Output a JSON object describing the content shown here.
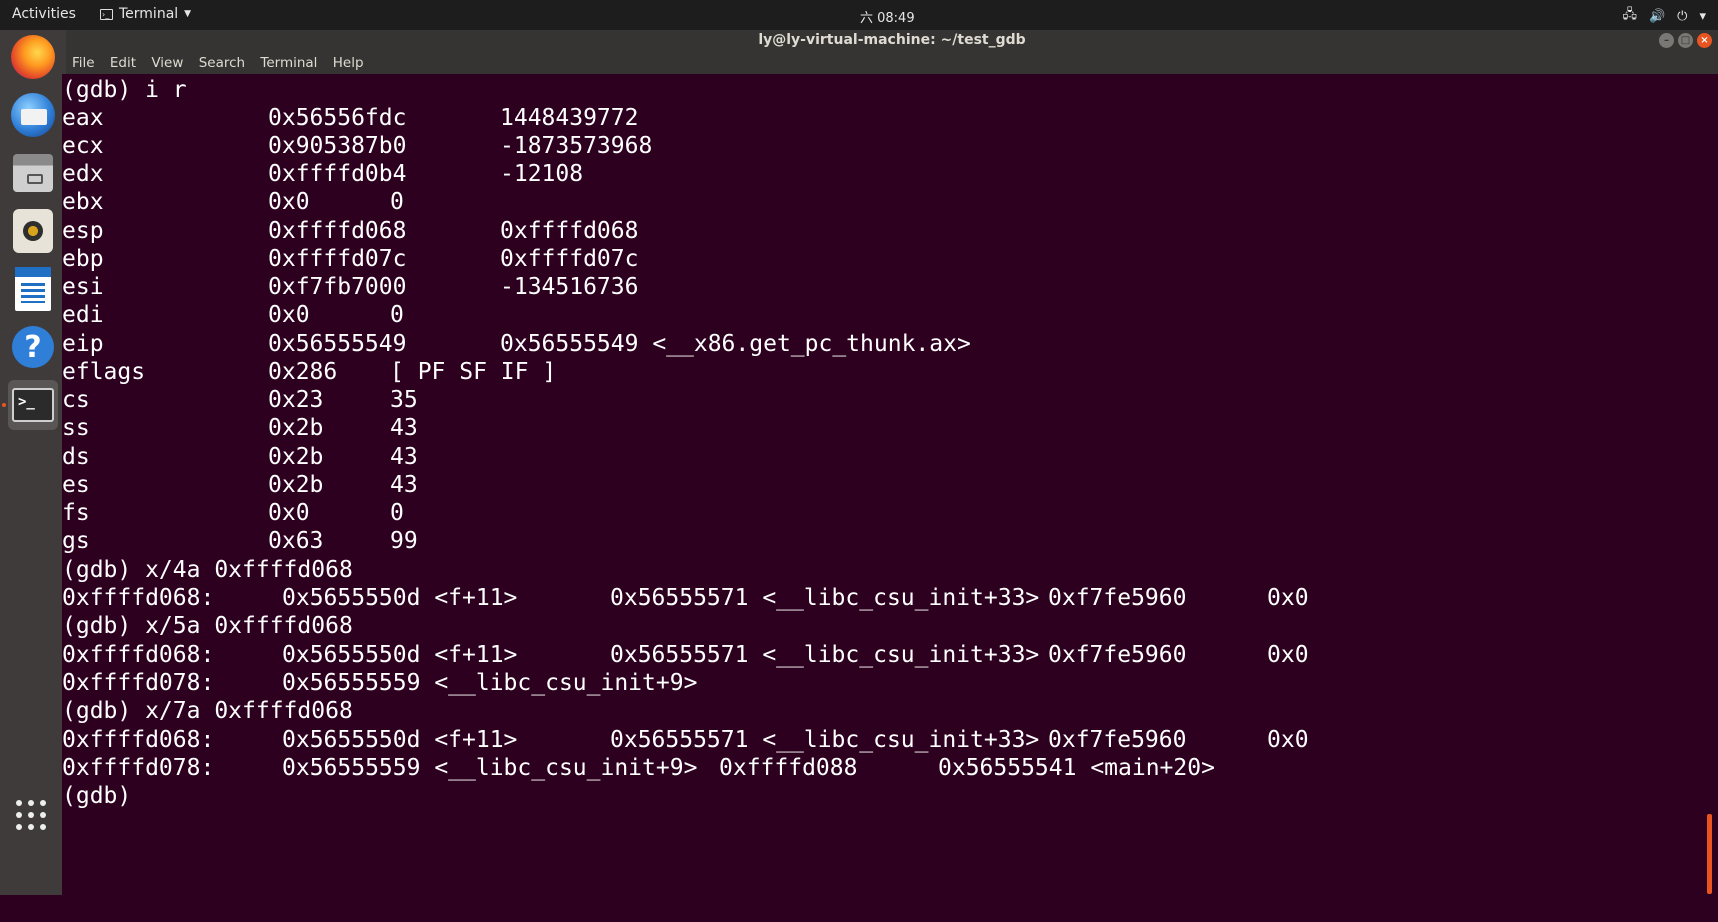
{
  "topbar": {
    "activities": "Activities",
    "app_name": "Terminal",
    "clock": "六 08:49",
    "tray": [
      "network-icon",
      "volume-icon",
      "power-icon"
    ]
  },
  "dock": {
    "apps": [
      "Firefox",
      "Thunderbird",
      "Files",
      "Rhythmbox",
      "LibreOffice Writer",
      "Help",
      "Terminal"
    ]
  },
  "window": {
    "title": "ly@ly-virtual-machine: ~/test_gdb"
  },
  "menu": [
    "File",
    "Edit",
    "View",
    "Search",
    "Terminal",
    "Help"
  ],
  "terminal": {
    "cmd_ir": "(gdb) i r",
    "registers": [
      {
        "name": "eax",
        "hex": "0x56556fdc",
        "value": "1448439772"
      },
      {
        "name": "ecx",
        "hex": "0x905387b0",
        "value": "-1873573968"
      },
      {
        "name": "edx",
        "hex": "0xffffd0b4",
        "value": "-12108"
      },
      {
        "name": "ebx",
        "hex": "0x0",
        "value": "0"
      },
      {
        "name": "esp",
        "hex": "0xffffd068",
        "value": "0xffffd068"
      },
      {
        "name": "ebp",
        "hex": "0xffffd07c",
        "value": "0xffffd07c"
      },
      {
        "name": "esi",
        "hex": "0xf7fb7000",
        "value": "-134516736"
      },
      {
        "name": "edi",
        "hex": "0x0",
        "value": "0"
      },
      {
        "name": "eip",
        "hex": "0x56555549",
        "value": "0x56555549 <__x86.get_pc_thunk.ax>"
      },
      {
        "name": "eflags",
        "hex": "0x286",
        "value": "[ PF SF IF ]"
      },
      {
        "name": "cs",
        "hex": "0x23",
        "value": "35"
      },
      {
        "name": "ss",
        "hex": "0x2b",
        "value": "43"
      },
      {
        "name": "ds",
        "hex": "0x2b",
        "value": "43"
      },
      {
        "name": "es",
        "hex": "0x2b",
        "value": "43"
      },
      {
        "name": "fs",
        "hex": "0x0",
        "value": "0"
      },
      {
        "name": "gs",
        "hex": "0x63",
        "value": "99"
      }
    ],
    "cmd_x4a": "(gdb) x/4a 0xffffd068",
    "x4a_row1": {
      "addr": "0xffffd068:",
      "c1": "0x5655550d <f+11>",
      "c2": "0x56555571 <__libc_csu_init+33>",
      "c3": "0xf7fe5960",
      "c4": "0x0"
    },
    "cmd_x5a": "(gdb) x/5a 0xffffd068",
    "x5a_row1": {
      "addr": "0xffffd068:",
      "c1": "0x5655550d <f+11>",
      "c2": "0x56555571 <__libc_csu_init+33>",
      "c3": "0xf7fe5960",
      "c4": "0x0"
    },
    "x5a_row2": {
      "addr": "0xffffd078:",
      "c1": "0x56555559 <__libc_csu_init+9>"
    },
    "cmd_x7a": "(gdb) x/7a 0xffffd068",
    "x7a_row1": {
      "addr": "0xffffd068:",
      "c1": "0x5655550d <f+11>",
      "c2": "0x56555571 <__libc_csu_init+33>",
      "c3": "0xf7fe5960",
      "c4": "0x0"
    },
    "x7a_row2": {
      "addr": "0xffffd078:",
      "c1": "0x56555559 <__libc_csu_init+9>",
      "c2": "0xffffd088",
      "c3": "0x56555541 <main+20>"
    },
    "prompt": "(gdb)"
  },
  "colors": {
    "terminal_bg": "#2c001e",
    "accent": "#e95420"
  }
}
